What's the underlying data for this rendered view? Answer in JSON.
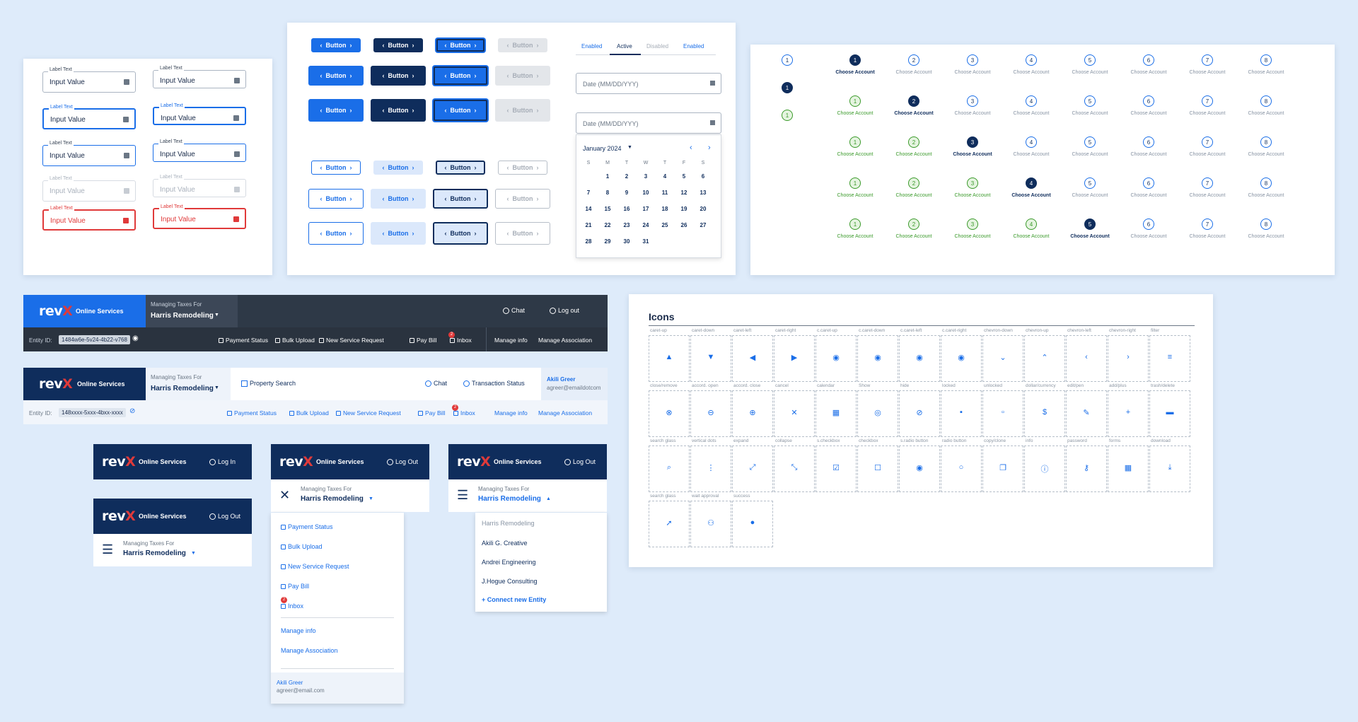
{
  "inputs": {
    "label": "Label Text",
    "value": "Input Value"
  },
  "buttons": {
    "label": "Button",
    "chev_left": "‹",
    "chev_right": "›"
  },
  "tabs": [
    "Enabled",
    "Active",
    "Disabled",
    "Enabled"
  ],
  "date": {
    "placeholder": "Date (MM/DD/YYY)",
    "month": "January 2024",
    "weekdays": [
      "S",
      "M",
      "T",
      "W",
      "T",
      "F",
      "S"
    ],
    "weeks": [
      [
        "",
        "1",
        "2",
        "3",
        "4",
        "5",
        "6"
      ],
      [
        "7",
        "8",
        "9",
        "10",
        "11",
        "12",
        "13"
      ],
      [
        "14",
        "15",
        "16",
        "17",
        "18",
        "19",
        "20"
      ],
      [
        "21",
        "22",
        "23",
        "24",
        "25",
        "26",
        "27"
      ],
      [
        "28",
        "29",
        "30",
        "31",
        "",
        "",
        ""
      ]
    ]
  },
  "stepper": {
    "label": "Choose Account",
    "numbers": [
      "1",
      "2",
      "3",
      "4",
      "5",
      "6",
      "7",
      "8"
    ],
    "current_steps": [
      1,
      2,
      3,
      4,
      5
    ],
    "mini": [
      "1",
      "1",
      "1"
    ]
  },
  "header1": {
    "logo_a": "rev",
    "logo_b": "X",
    "online": "Online Services",
    "managing": "Managing Taxes For",
    "entity": "Harris Remodeling",
    "chat": "Chat",
    "logout": "Log out",
    "entity_id_label": "Entity ID:",
    "entity_id": "1484w6e-5v24-4b22-v768",
    "links": [
      "Payment Status",
      "Bulk Upload",
      "New Service Request",
      "Pay Bill",
      "Inbox"
    ],
    "right_links": [
      "Manage info",
      "Manage Association"
    ],
    "badge": "2"
  },
  "header2": {
    "online": "Online Services",
    "managing": "Managing Taxes For",
    "entity": "Harris Remodeling",
    "property": "Property Search",
    "chat": "Chat",
    "tx": "Transaction Status",
    "user": "Akili Greer",
    "email": "agreer@emaildotcom",
    "entity_id_label": "Entity ID:",
    "entity_id": "148xxxx-5xxx-4bxx-xxxx",
    "links": [
      "Payment Status",
      "Bulk Upload",
      "New Service Request",
      "Pay Bill",
      "Inbox"
    ],
    "right_links": [
      "Manage info",
      "Manage Association"
    ],
    "badge": "2"
  },
  "mobile": {
    "online": "Online Services",
    "login": "Log In",
    "logout": "Log Out",
    "managing": "Managing Taxes For",
    "entity": "Harris Remodeling",
    "menu": [
      "Payment Status",
      "Bulk Upload",
      "New Service Request",
      "Pay Bill",
      "Inbox"
    ],
    "menu2": [
      "Manage info",
      "Manage Association"
    ],
    "user": "Akili Greer",
    "email": "agreer@email.com",
    "badge": "2",
    "entities_current": "Harris Remodeling",
    "entities": [
      "Akili G. Creative",
      "Andrei Engineering",
      "J.Hogue Consulting"
    ],
    "connect": "+ Connect new Entity"
  },
  "icons": {
    "title": "Icons",
    "rows": [
      [
        "caret-up",
        "caret-down",
        "caret-left",
        "caret-right",
        "c.caret-up",
        "c.caret-down",
        "c.caret-left",
        "c.caret-right",
        "chevron-down",
        "chevron-up",
        "chevron-left",
        "chevron-right",
        "filter"
      ],
      [
        "close/remove",
        "accord. open",
        "accord. close",
        "cancel",
        "calendar",
        "Show",
        "hide",
        "locked",
        "unlocked",
        "dollar/currency",
        "edit/pen",
        "add/plus",
        "trash/delete"
      ],
      [
        "search glass",
        "vertical dots",
        "expand",
        "collapse",
        "s.checkbox",
        "checkbox",
        "s.radio button",
        "radio button",
        "copy/clone",
        "info",
        "password",
        "forms",
        "download"
      ],
      [
        "search glass",
        "wait approval",
        "success"
      ]
    ],
    "glyphs": [
      [
        "▲",
        "▼",
        "◀",
        "▶",
        "◉",
        "◉",
        "◉",
        "◉",
        "⌄",
        "⌃",
        "‹",
        "›",
        "≡"
      ],
      [
        "⊗",
        "⊖",
        "⊕",
        "✕",
        "▦",
        "◎",
        "⊘",
        "▪",
        "▫",
        "$",
        "✎",
        "+",
        "▬"
      ],
      [
        "⌕",
        "⋮",
        "⤢",
        "⤡",
        "☑",
        "☐",
        "◉",
        "○",
        "❐",
        "ⓘ",
        "⚷",
        "▦",
        "⤓"
      ],
      [
        "➚",
        "⚇",
        "●"
      ]
    ]
  }
}
